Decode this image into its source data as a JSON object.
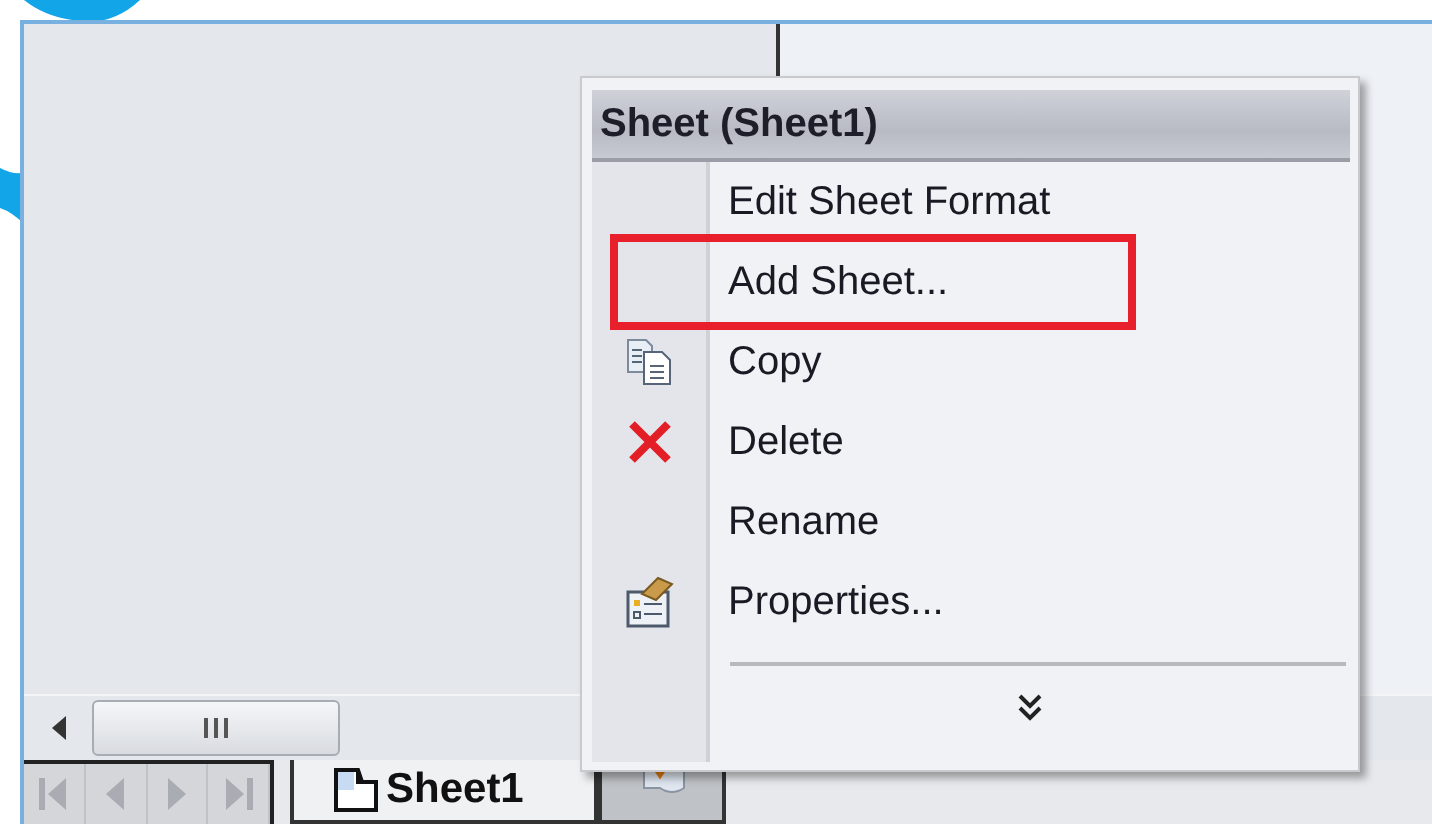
{
  "menu": {
    "title": "Sheet (Sheet1)",
    "items": [
      {
        "label": "Edit Sheet Format",
        "kind": "plain",
        "highlighted": false
      },
      {
        "label": "Add Sheet...",
        "kind": "plain",
        "highlighted": true
      },
      {
        "label": "Copy",
        "kind": "copy",
        "highlighted": false
      },
      {
        "label": "Delete",
        "kind": "delete",
        "highlighted": false
      },
      {
        "label": "Rename",
        "kind": "plain",
        "highlighted": false
      },
      {
        "label": "Properties...",
        "kind": "properties",
        "highlighted": false
      }
    ]
  },
  "sheet_tabs": [
    {
      "label": "Sheet1",
      "selected": true
    },
    {
      "selected": false
    }
  ]
}
